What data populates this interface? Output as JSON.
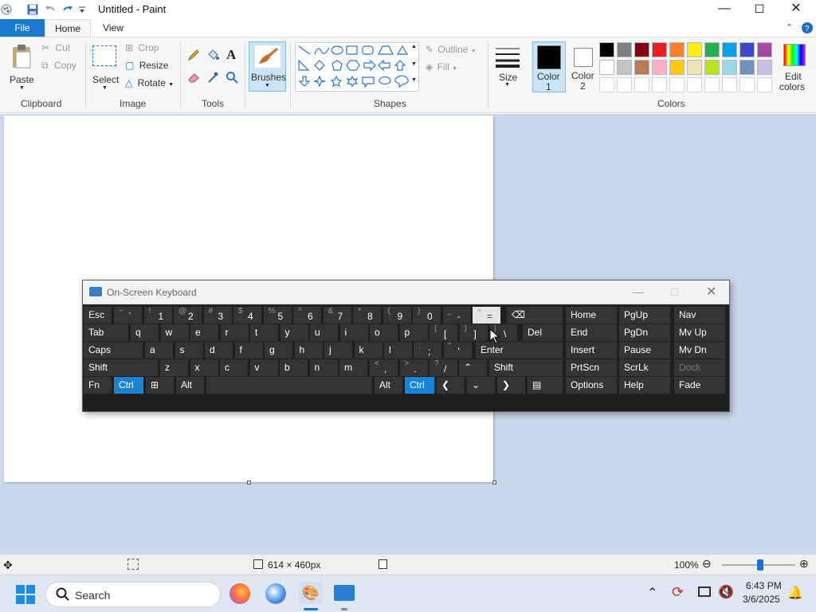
{
  "window": {
    "title": "Untitled - Paint",
    "controls": [
      "minimize",
      "maximize",
      "close"
    ]
  },
  "tabs": [
    {
      "label": "File",
      "active": false
    },
    {
      "label": "Home",
      "active": true
    },
    {
      "label": "View",
      "active": false
    }
  ],
  "ribbon": {
    "clipboard": {
      "group": "Clipboard",
      "paste": "Paste",
      "cut": "Cut",
      "copy": "Copy"
    },
    "image": {
      "group": "Image",
      "select": "Select",
      "crop": "Crop",
      "resize": "Resize",
      "rotate": "Rotate"
    },
    "tools": {
      "group": "Tools"
    },
    "brushes": "Brushes",
    "shapes": {
      "group": "Shapes",
      "outline": "Outline",
      "fill": "Fill"
    },
    "size": "Size",
    "color1": {
      "line1": "Color",
      "line2": "1",
      "value": "#000000"
    },
    "color2": {
      "line1": "Color",
      "line2": "2",
      "value": "#ffffff"
    },
    "colors": {
      "group": "Colors"
    },
    "edit_colors": {
      "line1": "Edit",
      "line2": "colors"
    },
    "palette_row1": [
      "#000000",
      "#7f7f7f",
      "#880015",
      "#ed1c24",
      "#ff7f27",
      "#fff200",
      "#22b14c",
      "#00a2e8",
      "#3f48cc",
      "#a349a4"
    ],
    "palette_row2": [
      "#ffffff",
      "#c3c3c3",
      "#b97a57",
      "#ffaec9",
      "#ffc90e",
      "#efe4b0",
      "#b5e61d",
      "#99d9ea",
      "#7092be",
      "#c8bfe7"
    ]
  },
  "osk": {
    "title": "On-Screen Keyboard",
    "row1": [
      {
        "shift": "~",
        "main": "`"
      },
      {
        "shift": "!",
        "main": "1"
      },
      {
        "shift": "@",
        "main": "2"
      },
      {
        "shift": "#",
        "main": "3"
      },
      {
        "shift": "$",
        "main": "4"
      },
      {
        "shift": "%",
        "main": "5"
      },
      {
        "shift": "^",
        "main": "6"
      },
      {
        "shift": "&",
        "main": "7"
      },
      {
        "shift": "*",
        "main": "8"
      },
      {
        "shift": "(",
        "main": "9"
      },
      {
        "shift": ")",
        "main": "0"
      },
      {
        "shift": "_",
        "main": "-"
      },
      {
        "shift": "+",
        "main": "="
      }
    ],
    "row2": [
      "q",
      "w",
      "e",
      "r",
      "t",
      "y",
      "u",
      "i",
      "o",
      "p"
    ],
    "row2_brackets": [
      {
        "shift": "{",
        "main": "["
      },
      {
        "shift": "}",
        "main": "]"
      },
      {
        "shift": "|",
        "main": "\\"
      }
    ],
    "row3": [
      "a",
      "s",
      "d",
      "f",
      "g",
      "h",
      "j",
      "k",
      "l"
    ],
    "row3_punct": [
      {
        "shift": ":",
        "main": ";"
      },
      {
        "shift": "\"",
        "main": "'"
      }
    ],
    "row4": [
      "z",
      "x",
      "c",
      "v",
      "b",
      "n",
      "m"
    ],
    "row4_punct": [
      {
        "shift": "<",
        "main": ","
      },
      {
        "shift": ">",
        "main": "."
      },
      {
        "shift": "?",
        "main": "/"
      }
    ],
    "labels": {
      "esc": "Esc",
      "tab": "Tab",
      "caps": "Caps",
      "shift": "Shift",
      "fn": "Fn",
      "ctrl": "Ctrl",
      "alt": "Alt",
      "del": "Del",
      "enter": "Enter",
      "home": "Home",
      "pgup": "PgUp",
      "nav": "Nav",
      "end": "End",
      "pgdn": "PgDn",
      "mvup": "Mv Up",
      "insert": "Insert",
      "pause": "Pause",
      "mvdn": "Mv Dn",
      "prtscn": "PrtScn",
      "scrlk": "ScrLk",
      "dock": "Dock",
      "options": "Options",
      "help": "Help",
      "fade": "Fade"
    }
  },
  "statusbar": {
    "dimensions": "614 × 460px",
    "zoom": "100%",
    "zoom_level_pct": 100
  },
  "taskbar": {
    "search": "Search",
    "time": "6:43 PM",
    "date": "3/6/2025"
  }
}
